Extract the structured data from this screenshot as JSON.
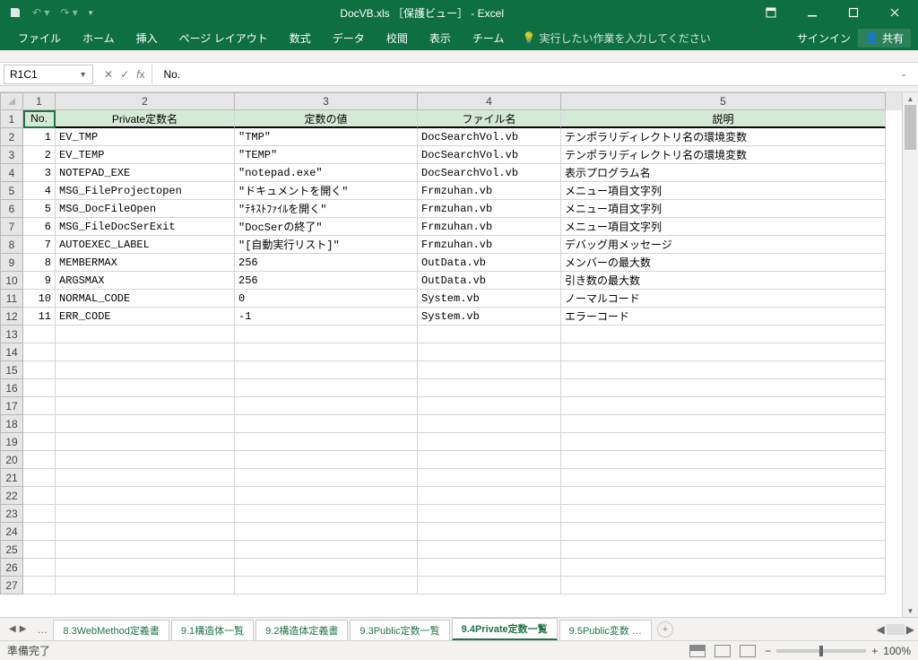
{
  "titlebar": {
    "title": "DocVB.xls ［保護ビュー］ - Excel"
  },
  "ribbon": {
    "tabs": [
      "ファイル",
      "ホーム",
      "挿入",
      "ページ レイアウト",
      "数式",
      "データ",
      "校閲",
      "表示",
      "チーム"
    ],
    "tell": "実行したい作業を入力してください",
    "signin": "サインイン",
    "share": "共有"
  },
  "formula": {
    "namebox": "R1C1",
    "value": "No."
  },
  "columns": [
    "1",
    "2",
    "3",
    "4",
    "5"
  ],
  "headers": {
    "c1": "No.",
    "c2": "Private定数名",
    "c3": "定数の値",
    "c4": "ファイル名",
    "c5": "説明"
  },
  "rows": [
    {
      "n": "1",
      "name": "EV_TMP",
      "val": "\"TMP\"",
      "file": "DocSearchVol.vb",
      "desc": "テンポラリディレクトリ名の環境変数"
    },
    {
      "n": "2",
      "name": "EV_TEMP",
      "val": "\"TEMP\"",
      "file": "DocSearchVol.vb",
      "desc": "テンポラリディレクトリ名の環境変数"
    },
    {
      "n": "3",
      "name": "NOTEPAD_EXE",
      "val": "\"notepad.exe\"",
      "file": "DocSearchVol.vb",
      "desc": "表示プログラム名"
    },
    {
      "n": "4",
      "name": "MSG_FileProjectopen",
      "val": "\"ドキュメントを開く\"",
      "file": "Frmzuhan.vb",
      "desc": "メニュー項目文字列"
    },
    {
      "n": "5",
      "name": "MSG_DocFileOpen",
      "val": "\"ﾃｷｽﾄﾌｧｲﾙを開く\"",
      "file": "Frmzuhan.vb",
      "desc": "メニュー項目文字列"
    },
    {
      "n": "6",
      "name": "MSG_FileDocSerExit",
      "val": "\"DocSerの終了\"",
      "file": "Frmzuhan.vb",
      "desc": "メニュー項目文字列"
    },
    {
      "n": "7",
      "name": "AUTOEXEC_LABEL",
      "val": "\"[自動実行リスト]\"",
      "file": "Frmzuhan.vb",
      "desc": "デバッグ用メッセージ"
    },
    {
      "n": "8",
      "name": "MEMBERMAX",
      "val": "256",
      "file": "OutData.vb",
      "desc": "メンバーの最大数"
    },
    {
      "n": "9",
      "name": "ARGSMAX",
      "val": "256",
      "file": "OutData.vb",
      "desc": "引き数の最大数"
    },
    {
      "n": "10",
      "name": "NORMAL_CODE",
      "val": "0",
      "file": "System.vb",
      "desc": "ノーマルコード"
    },
    {
      "n": "11",
      "name": "ERR_CODE",
      "val": "-1",
      "file": "System.vb",
      "desc": "エラーコード"
    }
  ],
  "empty_row_labels": [
    "13",
    "14",
    "15",
    "16",
    "17",
    "18",
    "19",
    "20",
    "21",
    "22",
    "23",
    "24",
    "25",
    "26",
    "27"
  ],
  "sheet_tabs": [
    "8.3WebMethod定義書",
    "9.1構造体一覧",
    "9.2構造体定義書",
    "9.3Public定数一覧",
    "9.4Private定数一覧",
    "9.5Public変数 …"
  ],
  "active_sheet_index": 4,
  "status": {
    "ready": "準備完了",
    "zoom": "100%"
  }
}
